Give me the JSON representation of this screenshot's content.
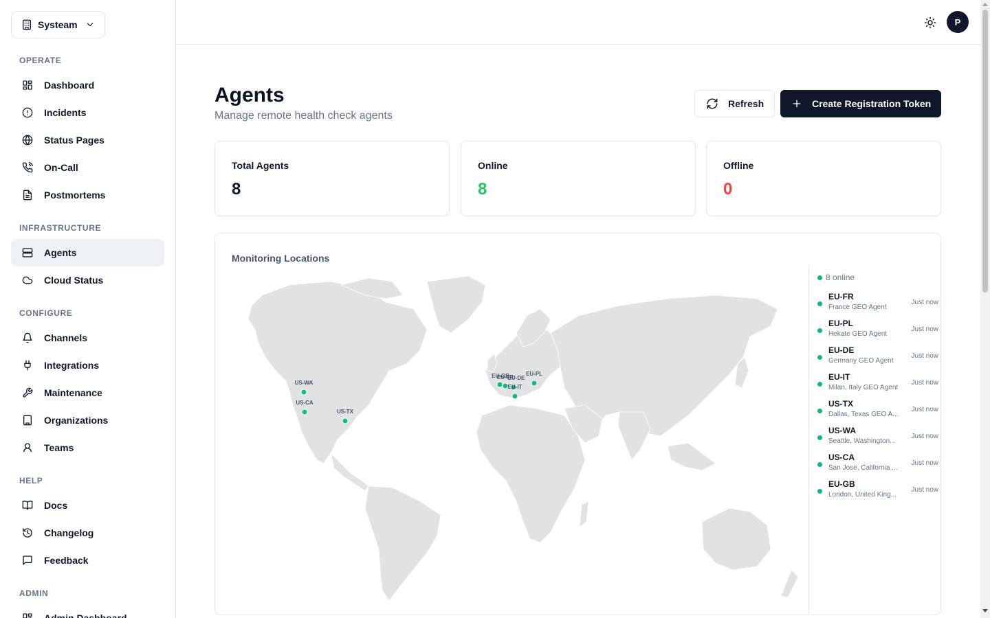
{
  "org": {
    "name": "Systeam"
  },
  "sidebar": {
    "sections": [
      {
        "title": "OPERATE",
        "items": [
          {
            "label": "Dashboard",
            "icon": "dashboard-icon"
          },
          {
            "label": "Incidents",
            "icon": "alert-circle-icon"
          },
          {
            "label": "Status Pages",
            "icon": "globe-icon"
          },
          {
            "label": "On-Call",
            "icon": "phone-icon"
          },
          {
            "label": "Postmortems",
            "icon": "document-icon"
          }
        ]
      },
      {
        "title": "INFRASTRUCTURE",
        "items": [
          {
            "label": "Agents",
            "icon": "server-icon",
            "active": true
          },
          {
            "label": "Cloud Status",
            "icon": "cloud-icon"
          }
        ]
      },
      {
        "title": "CONFIGURE",
        "items": [
          {
            "label": "Channels",
            "icon": "bell-icon"
          },
          {
            "label": "Integrations",
            "icon": "plug-icon"
          },
          {
            "label": "Maintenance",
            "icon": "wrench-icon"
          },
          {
            "label": "Organizations",
            "icon": "building-icon"
          },
          {
            "label": "Teams",
            "icon": "user-icon"
          }
        ]
      },
      {
        "title": "HELP",
        "items": [
          {
            "label": "Docs",
            "icon": "book-icon"
          },
          {
            "label": "Changelog",
            "icon": "history-icon"
          },
          {
            "label": "Feedback",
            "icon": "message-icon"
          }
        ]
      },
      {
        "title": "ADMIN",
        "items": [
          {
            "label": "Admin Dashboard",
            "icon": "dashboard-icon"
          }
        ]
      }
    ]
  },
  "header": {
    "avatar_initial": "P",
    "theme_icon": "sun-icon"
  },
  "page": {
    "title": "Agents",
    "subtitle": "Manage remote health check agents",
    "refresh_label": "Refresh",
    "create_label": "Create Registration Token"
  },
  "stats": [
    {
      "label": "Total Agents",
      "value": "8",
      "color": "#0f172a"
    },
    {
      "label": "Online",
      "value": "8",
      "color": "#22c55e"
    },
    {
      "label": "Offline",
      "value": "0",
      "color": "#ef4444"
    }
  ],
  "map": {
    "title": "Monitoring Locations",
    "online_summary": "8 online",
    "markers": [
      {
        "label": "US-WA"
      },
      {
        "label": "US-CA"
      },
      {
        "label": "US-TX"
      },
      {
        "label": "EU-GB"
      },
      {
        "label": "EU-FR"
      },
      {
        "label": "EU-DE"
      },
      {
        "label": "EU-IT"
      },
      {
        "label": "EU-PL"
      }
    ]
  },
  "agents": [
    {
      "name": "EU-FR",
      "desc": "France GEO Agent",
      "seen": "Just now"
    },
    {
      "name": "EU-PL",
      "desc": "Hekate GEO Agent",
      "seen": "Just now"
    },
    {
      "name": "EU-DE",
      "desc": "Germany GEO Agent",
      "seen": "Just now"
    },
    {
      "name": "EU-IT",
      "desc": "Milan, Italy GEO Agent",
      "seen": "Just now"
    },
    {
      "name": "US-TX",
      "desc": "Dallas, Texas GEO A...",
      "seen": "Just now"
    },
    {
      "name": "US-WA",
      "desc": "Seattle, Washington...",
      "seen": "Just now"
    },
    {
      "name": "US-CA",
      "desc": "San Jose, California ...",
      "seen": "Just now"
    },
    {
      "name": "EU-GB",
      "desc": "London, United King...",
      "seen": "Just now"
    }
  ],
  "colors": {
    "accent": "#0f172a",
    "online": "#10b981",
    "offline": "#ef4444",
    "land": "#e2e2e2"
  }
}
